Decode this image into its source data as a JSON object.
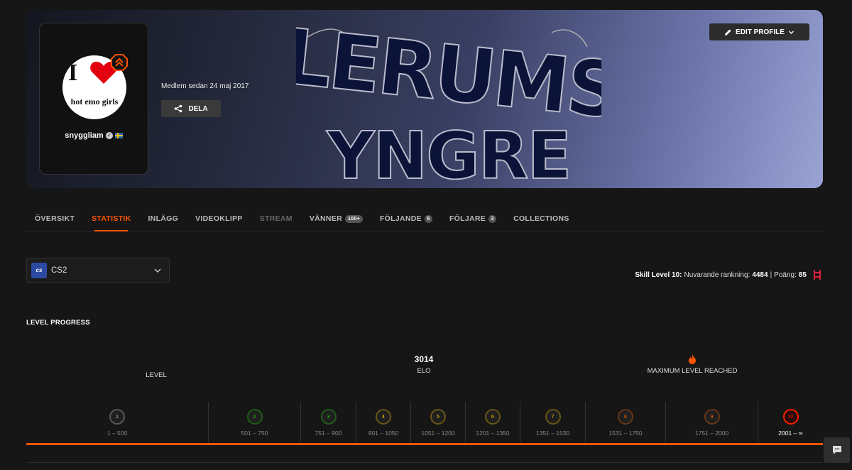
{
  "profile": {
    "username": "snyggliam",
    "member_since": "Medlem sedan 24 maj 2017",
    "share_label": "DELA",
    "edit_label": "EDIT PROFILE",
    "avatar_text_top": "I",
    "avatar_text_bottom": "hot emo girls",
    "banner_text": "LERUMS YNGRE"
  },
  "tabs": [
    {
      "label": "ÖVERSIKT"
    },
    {
      "label": "STATISTIK",
      "active": true
    },
    {
      "label": "INLÄGG"
    },
    {
      "label": "VIDEOKLIPP"
    },
    {
      "label": "STREAM",
      "muted": true
    },
    {
      "label": "VÄNNER",
      "badge": "100+"
    },
    {
      "label": "FÖLJANDE",
      "badge": "5"
    },
    {
      "label": "FÖLJARE",
      "badge": "3"
    },
    {
      "label": "COLLECTIONS"
    }
  ],
  "game": {
    "name": "CS2",
    "logo_text": "cs"
  },
  "skill": {
    "prefix": "Skill Level 10:",
    "rank_label": "Nuvarande rankning:",
    "rank_value": "4484",
    "separator": "|",
    "points_label": "Poäng:",
    "points_value": "85"
  },
  "level_progress": {
    "title": "LEVEL PROGRESS",
    "level_label": "LEVEL",
    "elo_value": "3014",
    "elo_label": "ELO",
    "max_label": "MAXIMUM LEVEL REACHED",
    "progress_fraction": 1.0,
    "levels": [
      {
        "level": "1",
        "range": "1 – 500",
        "color": "#cfcfcf"
      },
      {
        "level": "2",
        "range": "501 – 750",
        "color": "#1ce400"
      },
      {
        "level": "3",
        "range": "751 – 900",
        "color": "#1ce400"
      },
      {
        "level": "4",
        "range": "901 – 1050",
        "color": "#ffc800"
      },
      {
        "level": "5",
        "range": "1051 – 1200",
        "color": "#ffc800"
      },
      {
        "level": "6",
        "range": "1201 – 1350",
        "color": "#ffc800"
      },
      {
        "level": "7",
        "range": "1351 – 1530",
        "color": "#ffc800"
      },
      {
        "level": "8",
        "range": "1531 – 1750",
        "color": "#ff6309"
      },
      {
        "level": "9",
        "range": "1751 – 2000",
        "color": "#ff6309"
      },
      {
        "level": "10",
        "range": "2001 – ∞",
        "color": "#fe1f00",
        "current": true
      }
    ]
  },
  "colors": {
    "accent": "#ff5500"
  }
}
